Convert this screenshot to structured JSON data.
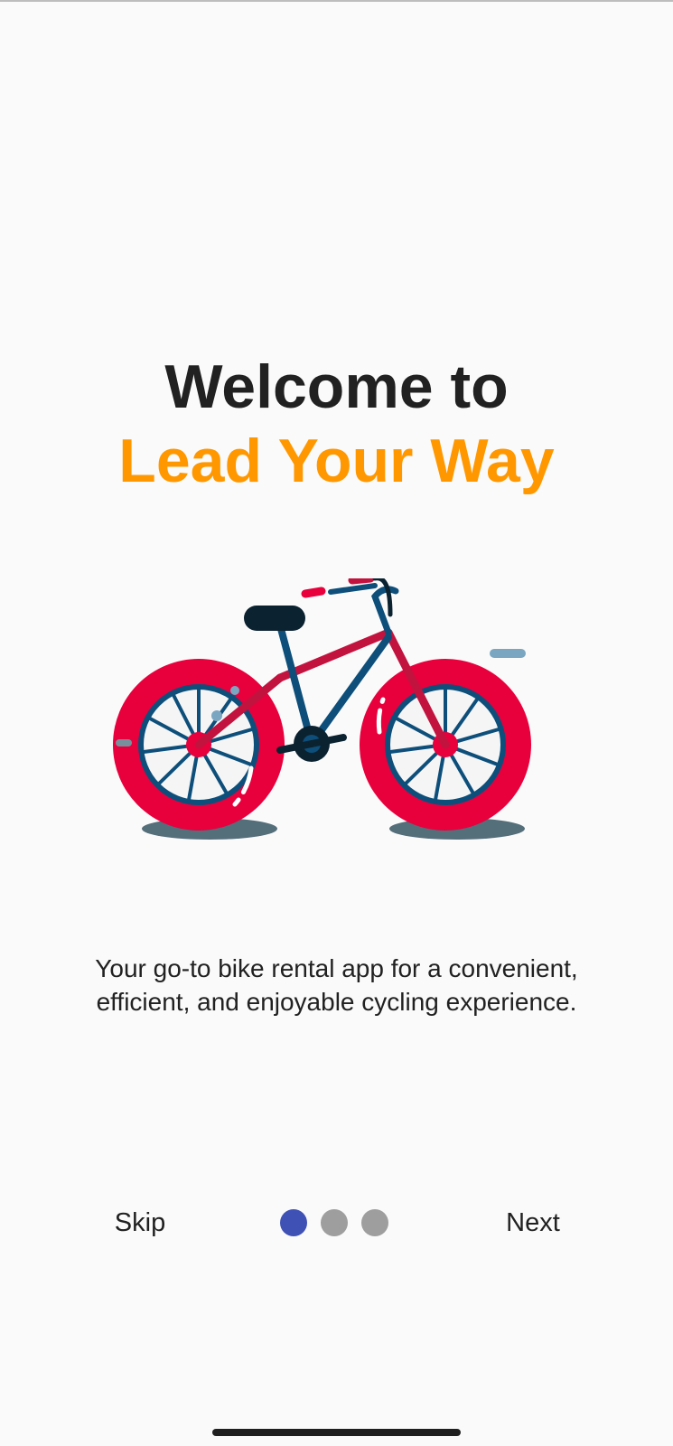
{
  "onboarding": {
    "title_line1": "Welcome to",
    "title_line2": "Lead Your Way",
    "description": "Your go-to bike rental app for a convenient, efficient, and enjoyable cycling experience.",
    "illustration": "bicycle-illustration"
  },
  "pager": {
    "total_pages": 3,
    "current_page": 1
  },
  "actions": {
    "skip_label": "Skip",
    "next_label": "Next"
  },
  "colors": {
    "title_dark": "#212121",
    "title_accent": "#ff9800",
    "dot_active": "#3f51b5",
    "dot_inactive": "#9e9e9e",
    "bike_frame": "#c2133f",
    "bike_tire": "#e8003d",
    "bike_rim": "#0d4f7a"
  }
}
